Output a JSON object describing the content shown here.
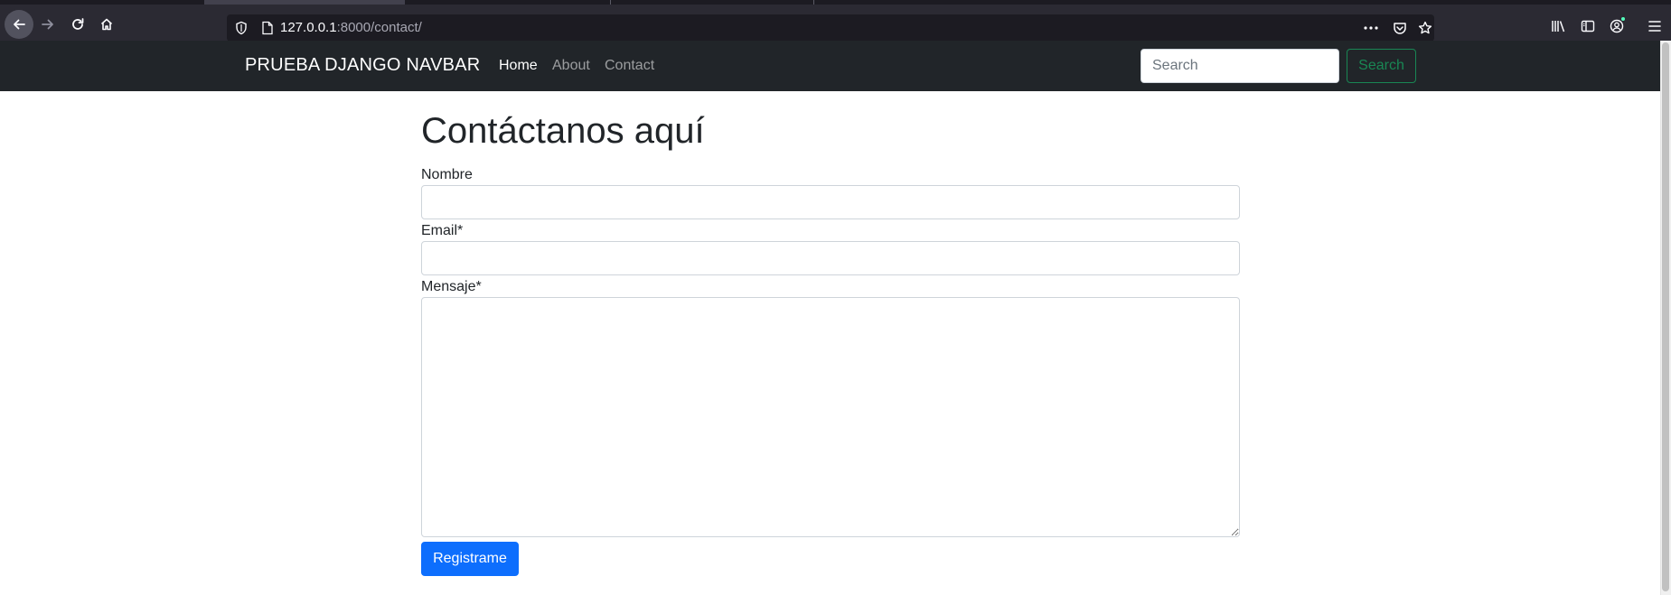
{
  "browser": {
    "url_host": "127.0.0.1",
    "url_rest": ":8000/contact/",
    "icons": {
      "back": "back-arrow-icon",
      "forward": "forward-arrow-icon",
      "reload": "reload-icon",
      "home": "home-icon",
      "tracking": "shield-icon",
      "page": "page-icon",
      "more": "more-icon",
      "pocket": "pocket-icon",
      "bookmark": "star-icon",
      "library": "library-icon",
      "sidebar": "sidebar-icon",
      "account": "account-icon",
      "menu": "hamburger-menu-icon"
    }
  },
  "navbar": {
    "brand": "PRUEBA DJANGO NAVBAR",
    "links": [
      {
        "label": "Home",
        "active": true
      },
      {
        "label": "About",
        "active": false
      },
      {
        "label": "Contact",
        "active": false
      }
    ],
    "search": {
      "placeholder": "Search",
      "button_label": "Search"
    }
  },
  "form": {
    "title": "Contáctanos aquí",
    "fields": {
      "nombre_label": "Nombre",
      "email_label": "Email*",
      "mensaje_label": "Mensaje*"
    },
    "submit_label": "Registrame"
  },
  "colors": {
    "navbar_bg": "#212529",
    "primary": "#0d6efd",
    "success": "#198754",
    "chrome_bg": "#2b2a33"
  }
}
